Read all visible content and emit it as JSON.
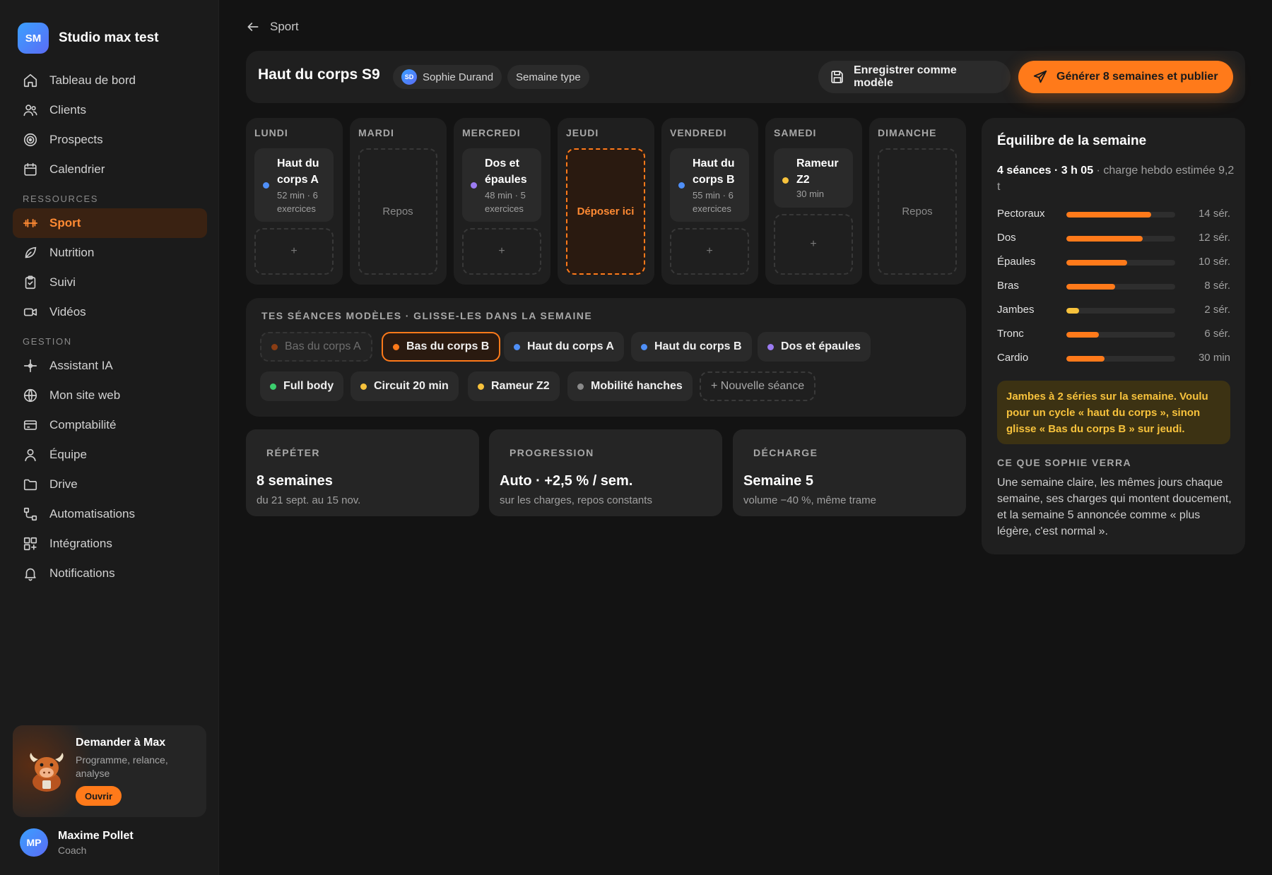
{
  "brand": {
    "initials": "SM",
    "name": "Studio max test"
  },
  "nav": {
    "main": [
      {
        "label": "Tableau de bord",
        "icon": "home-icon"
      },
      {
        "label": "Clients",
        "icon": "users-icon"
      },
      {
        "label": "Prospects",
        "icon": "target-icon"
      },
      {
        "label": "Calendrier",
        "icon": "calendar-icon"
      }
    ],
    "section_resources": "RESSOURCES",
    "resources": [
      {
        "label": "Sport",
        "icon": "dumbbell-icon",
        "active": true
      },
      {
        "label": "Nutrition",
        "icon": "leaf-icon"
      },
      {
        "label": "Suivi",
        "icon": "clipboard-check-icon"
      },
      {
        "label": "Vidéos",
        "icon": "video-icon"
      }
    ],
    "section_management": "GESTION",
    "management": [
      {
        "label": "Assistant IA",
        "icon": "sparkle-icon"
      },
      {
        "label": "Mon site web",
        "icon": "globe-icon"
      },
      {
        "label": "Comptabilité",
        "icon": "credit-card-icon"
      },
      {
        "label": "Équipe",
        "icon": "user-icon"
      },
      {
        "label": "Drive",
        "icon": "folder-icon"
      },
      {
        "label": "Automatisations",
        "icon": "workflow-icon"
      },
      {
        "label": "Intégrations",
        "icon": "grid-plus-icon"
      },
      {
        "label": "Notifications",
        "icon": "bell-icon"
      }
    ]
  },
  "assistant_card": {
    "title": "Demander à Max",
    "subtitle": "Programme, relance, analyse",
    "button": "Ouvrir"
  },
  "user": {
    "initials": "MP",
    "name": "Maxime Pollet",
    "role": "Coach"
  },
  "breadcrumb": {
    "back_label": "Sport"
  },
  "header": {
    "title": "Haut du corps S9",
    "client_initials": "SD",
    "client_name": "Sophie Durand",
    "tag": "Semaine type",
    "save_button": "Enregistrer comme modèle",
    "generate_button": "Générer 8 semaines et publier"
  },
  "week": {
    "add_symbol": "+",
    "rest_label": "Repos",
    "drop_label": "Déposer ici",
    "days": [
      {
        "label": "LUNDI",
        "session": {
          "title": "Haut du corps A",
          "meta": "52 min · 6 exercices",
          "dot": "#4f8ff7"
        }
      },
      {
        "label": "MARDI"
      },
      {
        "label": "MERCREDI",
        "session": {
          "title": "Dos et épaules",
          "meta": "48 min · 5 exercices",
          "dot": "#9b7bf2"
        }
      },
      {
        "label": "JEUDI"
      },
      {
        "label": "VENDREDI",
        "session": {
          "title": "Haut du corps B",
          "meta": "55 min · 6 exercices",
          "dot": "#4f8ff7"
        }
      },
      {
        "label": "SAMEDI",
        "session": {
          "title": "Rameur Z2",
          "meta": "30 min",
          "dot": "#f7c23c"
        }
      },
      {
        "label": "DIMANCHE"
      }
    ]
  },
  "templates": {
    "heading": "TES SÉANCES MODÈLES · GLISSE-LES DANS LA SEMAINE",
    "items": [
      {
        "label": "Bas du corps A",
        "dot": "#8a3d14"
      },
      {
        "label": "Bas du corps B",
        "dot": "#ff7a1a"
      },
      {
        "label": "Haut du corps A",
        "dot": "#4f8ff7"
      },
      {
        "label": "Haut du corps B",
        "dot": "#4f8ff7"
      },
      {
        "label": "Dos et épaules",
        "dot": "#9b7bf2"
      },
      {
        "label": "Full body",
        "dot": "#3ccf6e"
      },
      {
        "label": "Circuit 20 min",
        "dot": "#f7c23c"
      },
      {
        "label": "Rameur Z2",
        "dot": "#f7c23c"
      },
      {
        "label": "Mobilité hanches",
        "dot": "#8a8a8a"
      },
      {
        "label": "+ Nouvelle séance"
      }
    ]
  },
  "stats": [
    {
      "label": "RÉPÉTER",
      "value": "8 semaines",
      "sub": "du 21 sept. au 15 nov."
    },
    {
      "label": "PROGRESSION",
      "value": "Auto · +2,5 % / sem.",
      "sub": "sur les charges, repos constants"
    },
    {
      "label": "DÉCHARGE",
      "value": "Semaine 5",
      "sub": "volume −40 %, même trame"
    }
  ],
  "balance": {
    "title": "Équilibre de la semaine",
    "summary_bold": "4 séances · 3 h 05",
    "summary_rest": " · charge hebdo estimée 9,2 t",
    "rows": [
      {
        "name": "Pectoraux",
        "fraction": 0.78,
        "value": "14 sér.",
        "color": "#ff7a1a"
      },
      {
        "name": "Dos",
        "fraction": 0.7,
        "value": "12 sér.",
        "color": "#ff7a1a"
      },
      {
        "name": "Épaules",
        "fraction": 0.56,
        "value": "10 sér.",
        "color": "#ff7a1a"
      },
      {
        "name": "Bras",
        "fraction": 0.45,
        "value": "8 sér.",
        "color": "#ff7a1a"
      },
      {
        "name": "Jambes",
        "fraction": 0.12,
        "value": "2 sér.",
        "color": "#f7c23c"
      },
      {
        "name": "Tronc",
        "fraction": 0.3,
        "value": "6 sér.",
        "color": "#ff7a1a"
      },
      {
        "name": "Cardio",
        "fraction": 0.35,
        "value": "30 min",
        "color": "#ff7a1a"
      }
    ],
    "warning": "Jambes à 2 séries sur la semaine. Voulu pour un cycle « haut du corps », sinon glisse « Bas du corps B » sur jeudi.",
    "preview_heading": "CE QUE SOPHIE VERRA",
    "preview_text": "Une semaine claire, les mêmes jours chaque semaine, ses charges qui montent doucement, et la semaine 5 annoncée comme « plus légère, c'est normal »."
  }
}
